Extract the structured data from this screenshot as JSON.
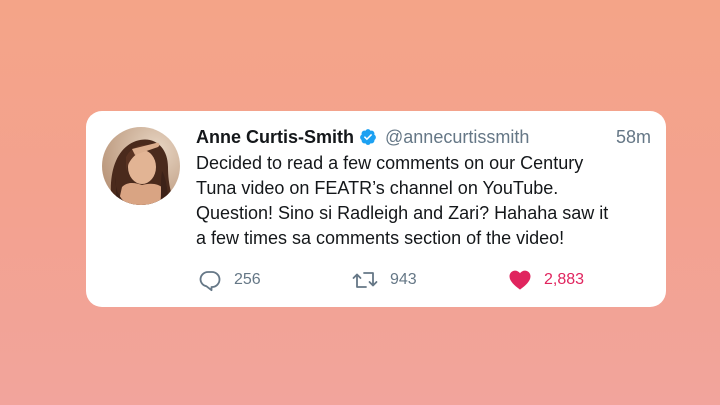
{
  "tweet": {
    "author_name": "Anne Curtis-Smith",
    "handle": "@annecurtissmith",
    "timestamp": "58m",
    "verified": true,
    "text_lines": [
      "Decided to read a few comments on our Century",
      "Tuna video on FEATR’s channel on YouTube.",
      "Question! Sino si Radleigh and Zari? Hahaha saw it",
      "a few times sa comments section of the video!"
    ],
    "actions": {
      "reply": {
        "icon": "reply-icon",
        "count": "256"
      },
      "retweet": {
        "icon": "retweet-icon",
        "count": "943"
      },
      "like": {
        "icon": "heart-icon",
        "count": "2,883",
        "liked": true
      }
    }
  },
  "colors": {
    "background_top": "#f4a488",
    "background_bottom": "#f2a49c",
    "card": "#ffffff",
    "text_primary": "#14171a",
    "text_secondary": "#657786",
    "verified_blue": "#1da1f2",
    "like_pink": "#e0245e"
  }
}
